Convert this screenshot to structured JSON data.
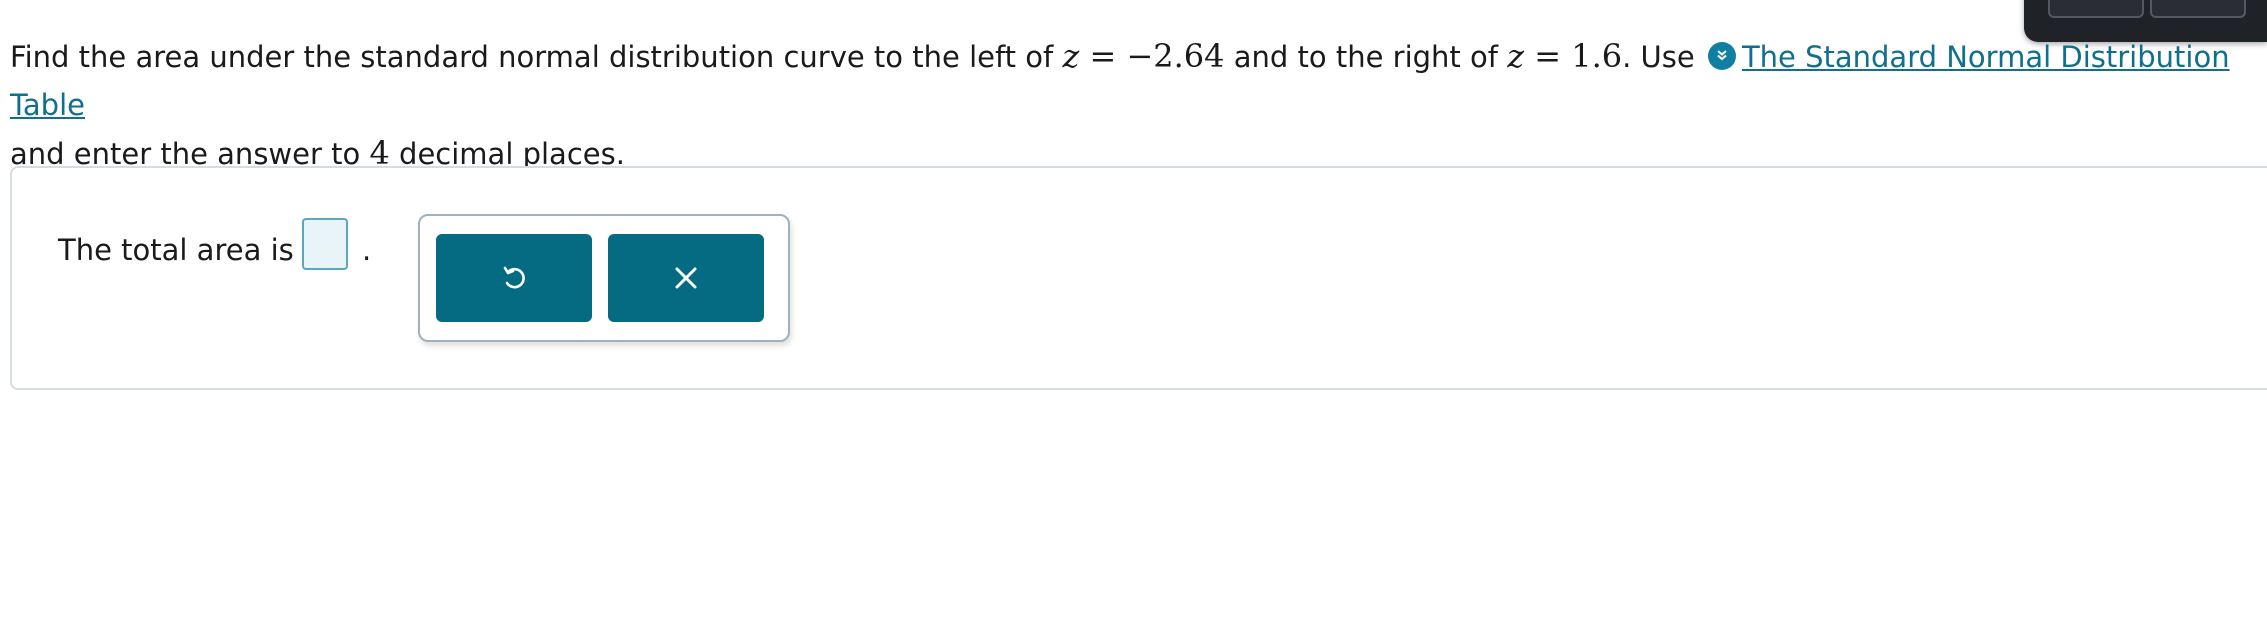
{
  "question": {
    "part1": "Find the area under the standard normal distribution curve to the left of ",
    "z1_var": "z",
    "z1_eq": " = ",
    "z1_value": "−2.64",
    "part2": " and to the right of ",
    "z2_var": "z",
    "z2_eq": " = ",
    "z2_value": "1.6",
    "part3": ". Use ",
    "link_label": "The Standard Normal Distribution Table",
    "part4": " and enter the answer to ",
    "decimal_count": "4",
    "part5": " decimal places."
  },
  "answer": {
    "prefix": "The total area is",
    "suffix": ".",
    "input_value": ""
  },
  "icons": {
    "link_icon": "chevron-double-down-icon",
    "undo_icon": "undo-icon",
    "clear_icon": "close-icon"
  },
  "colors": {
    "accent": "#056b82",
    "link": "#0f6f8c",
    "input_bg": "#e8f4f8"
  }
}
